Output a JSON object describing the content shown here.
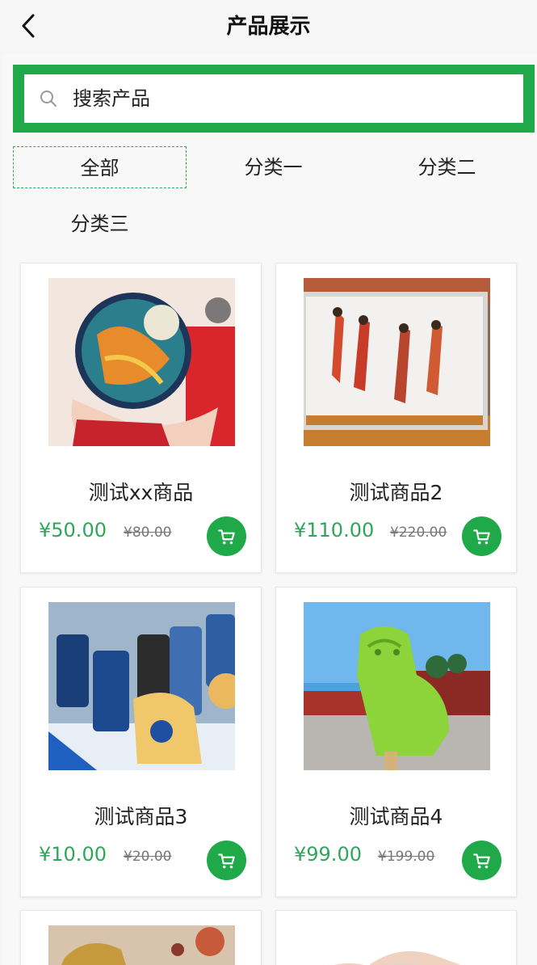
{
  "header": {
    "title": "产品展示",
    "back_icon": "chevron-left-icon"
  },
  "search": {
    "placeholder": "搜索产品",
    "icon": "search-icon"
  },
  "tabs": [
    {
      "label": "全部",
      "active": true
    },
    {
      "label": "分类一",
      "active": false
    },
    {
      "label": "分类二",
      "active": false
    },
    {
      "label": "分类三",
      "active": false
    }
  ],
  "products": [
    {
      "name": "测试xx商品",
      "price": "¥50.00",
      "old_price": "¥80.00"
    },
    {
      "name": "测试商品2",
      "price": "¥110.00",
      "old_price": "¥220.00"
    },
    {
      "name": "测试商品3",
      "price": "¥10.00",
      "old_price": "¥20.00"
    },
    {
      "name": "测试商品4",
      "price": "¥99.00",
      "old_price": "¥199.00"
    }
  ],
  "colors": {
    "accent": "#1fa948",
    "price": "#2fa65b",
    "active_tab_border": "#3aa160"
  },
  "cart_icon": "cart-icon"
}
